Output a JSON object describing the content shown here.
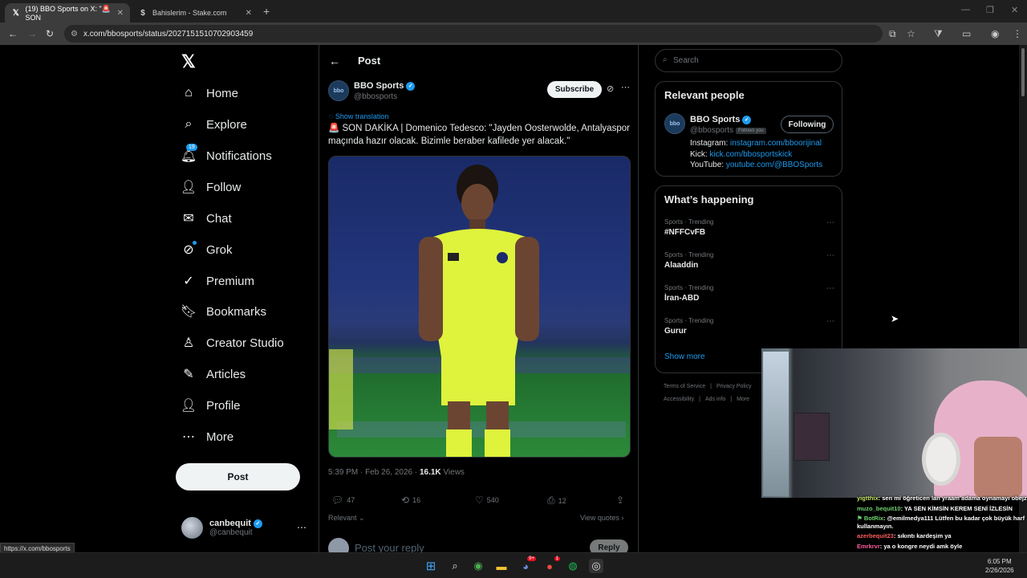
{
  "browser": {
    "tabs": [
      {
        "title": "(19) BBO Sports on X: \"🚨 SON",
        "active": true,
        "favicon": "X"
      },
      {
        "title": "Bahislerim - Stake.com",
        "active": false,
        "favicon": "S"
      }
    ],
    "url": "x.com/bbosports/status/2027151510702903459",
    "status_url": "https://x.com/bbosports"
  },
  "nav": {
    "items": [
      {
        "label": "Home",
        "icon": "home-icon",
        "glyph": "⌂"
      },
      {
        "label": "Explore",
        "icon": "search-icon",
        "glyph": "⌕"
      },
      {
        "label": "Notifications",
        "icon": "bell-icon",
        "glyph": "🔔︎",
        "badge": "19"
      },
      {
        "label": "Follow",
        "icon": "person-plus-icon",
        "glyph": "👤︎"
      },
      {
        "label": "Chat",
        "icon": "mail-icon",
        "glyph": "✉"
      },
      {
        "label": "Grok",
        "icon": "grok-icon",
        "glyph": "⊘",
        "dot": true
      },
      {
        "label": "Premium",
        "icon": "premium-icon",
        "glyph": "✓"
      },
      {
        "label": "Bookmarks",
        "icon": "bookmark-icon",
        "glyph": "🔖︎"
      },
      {
        "label": "Creator Studio",
        "icon": "creator-icon",
        "glyph": "♙"
      },
      {
        "label": "Articles",
        "icon": "articles-icon",
        "glyph": "✎"
      },
      {
        "label": "Profile",
        "icon": "profile-icon",
        "glyph": "👤︎"
      },
      {
        "label": "More",
        "icon": "more-circle-icon",
        "glyph": "⋯"
      }
    ],
    "post_button": "Post",
    "account": {
      "name": "canbequit",
      "handle": "@canbequit"
    }
  },
  "post": {
    "header": "Post",
    "author": {
      "name": "BBO Sports",
      "handle": "@bbosports",
      "avatar_text": "bbo"
    },
    "subscribe": "Subscribe",
    "show_translation": "Show translation",
    "text": "🚨 SON DAKİKA | Domenico Tedesco: \"Jayden Oosterwolde, Antalyaspor maçında hazır olacak. Bizimle beraber kafilede yer alacak.\"",
    "time": "5:39 PM · Feb 26, 2026 · ",
    "views_count": "16.1K",
    "views_label": " Views",
    "actions": {
      "replies": "47",
      "reposts": "16",
      "likes": "540",
      "bookmarks": "12"
    },
    "relevant": "Relevant",
    "view_quotes": "View quotes",
    "reply_placeholder": "Post your reply",
    "reply_button": "Reply"
  },
  "sidebar": {
    "search_placeholder": "Search",
    "relevant_people": {
      "title": "Relevant people",
      "name": "BBO Sports",
      "handle": "@bbosports",
      "follows_you": "Follows you",
      "following": "Following",
      "bio": [
        {
          "label": "Instagram: ",
          "link": "instagram.com/bboorijinal"
        },
        {
          "label": "Kick: ",
          "link": "kick.com/bbosportskick"
        },
        {
          "label": "YouTube: ",
          "link": "youtube.com/@BBOSports"
        }
      ]
    },
    "happening": {
      "title": "What’s happening",
      "trends": [
        {
          "category": "Sports · Trending",
          "topic": "#NFFCvFB"
        },
        {
          "category": "Sports · Trending",
          "topic": "Alaaddin"
        },
        {
          "category": "Sports · Trending",
          "topic": "İran-ABD"
        },
        {
          "category": "Sports · Trending",
          "topic": "Gurur"
        }
      ],
      "show_more": "Show more"
    },
    "footer": [
      [
        "Terms of Service",
        "|",
        "Privacy Policy"
      ],
      [
        "Accessibility",
        "|",
        "Ads info",
        "|",
        "More"
      ]
    ]
  },
  "chat": [
    {
      "user": "yigtthix",
      "msg": ": sen mi öğreticen lan yraam adama oynamayı obejz"
    },
    {
      "user": "muzo_bequit10",
      "msg": ": YA SEN KİMSİN KEREM SENİ İZLESİN"
    },
    {
      "user": "BotRix",
      "msg": ": @emilmedya111 Lütfen bu kadar çok büyük harf kullanmayın."
    },
    {
      "user": "azerbequit23",
      "msg": ": sıkıntı kardeşim ya"
    },
    {
      "user": "Emrkrvr",
      "msg": ": ya o kongre neydi amk öyle"
    }
  ],
  "taskbar": {
    "time": "6:05 PM",
    "date": "2/26/2026"
  }
}
